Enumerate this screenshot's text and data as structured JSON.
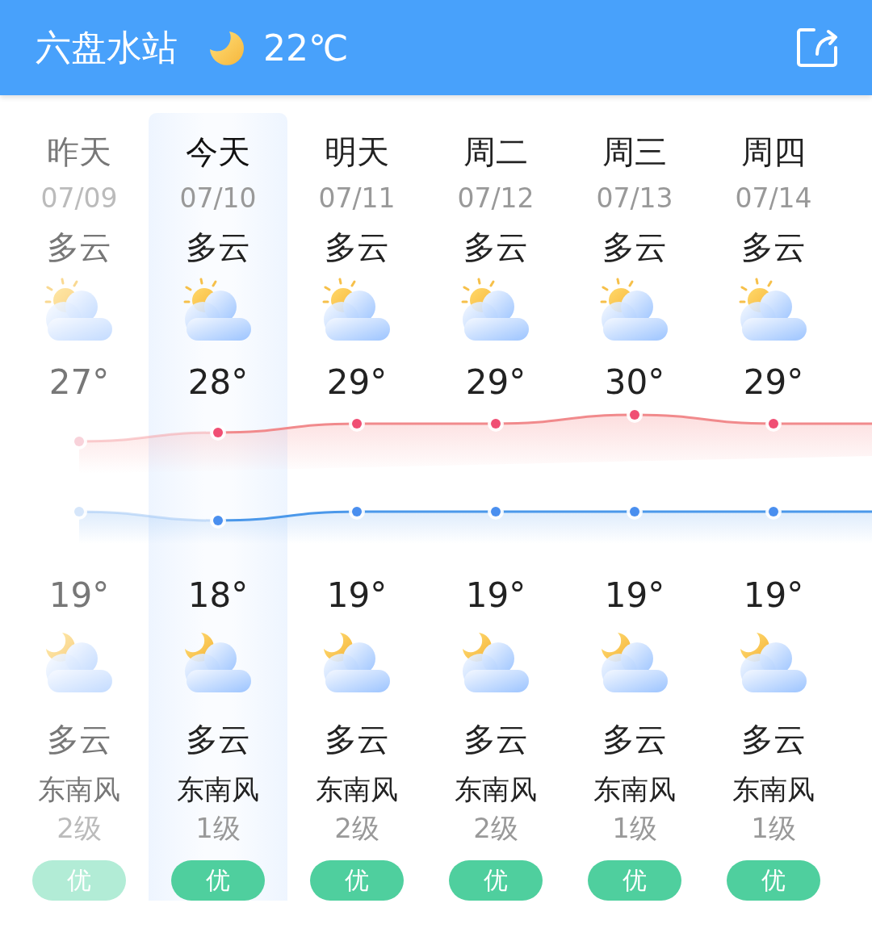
{
  "header": {
    "station": "六盘水站",
    "temperature": "22℃"
  },
  "days": [
    {
      "name": "昨天",
      "date": "07/09",
      "day_condition": "多云",
      "high": "27°",
      "low": "19°",
      "night_condition": "多云",
      "wind_direction": "东南风",
      "wind_level": "2级",
      "aqi": "优",
      "past": true,
      "selected": false
    },
    {
      "name": "今天",
      "date": "07/10",
      "day_condition": "多云",
      "high": "28°",
      "low": "18°",
      "night_condition": "多云",
      "wind_direction": "东南风",
      "wind_level": "1级",
      "aqi": "优",
      "past": false,
      "selected": true
    },
    {
      "name": "明天",
      "date": "07/11",
      "day_condition": "多云",
      "high": "29°",
      "low": "19°",
      "night_condition": "多云",
      "wind_direction": "东南风",
      "wind_level": "2级",
      "aqi": "优",
      "past": false,
      "selected": false
    },
    {
      "name": "周二",
      "date": "07/12",
      "day_condition": "多云",
      "high": "29°",
      "low": "19°",
      "night_condition": "多云",
      "wind_direction": "东南风",
      "wind_level": "2级",
      "aqi": "优",
      "past": false,
      "selected": false
    },
    {
      "name": "周三",
      "date": "07/13",
      "day_condition": "多云",
      "high": "30°",
      "low": "19°",
      "night_condition": "多云",
      "wind_direction": "东南风",
      "wind_level": "1级",
      "aqi": "优",
      "past": false,
      "selected": false
    },
    {
      "name": "周四",
      "date": "07/14",
      "day_condition": "多云",
      "high": "29°",
      "low": "19°",
      "night_condition": "多云",
      "wind_direction": "东南风",
      "wind_level": "1级",
      "aqi": "优",
      "past": false,
      "selected": false
    }
  ]
}
